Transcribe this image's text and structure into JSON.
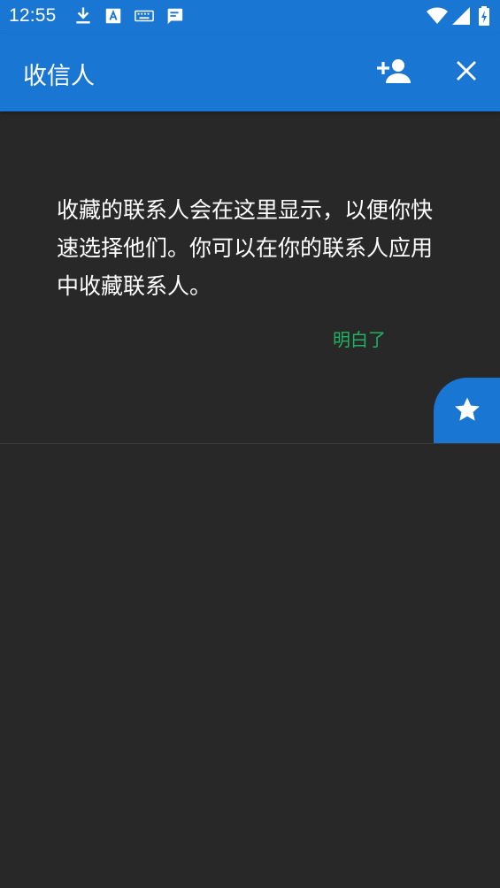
{
  "status_bar": {
    "time": "12:55",
    "icons": [
      "download-icon",
      "font-icon",
      "keyboard-icon",
      "message-icon",
      "wifi-icon",
      "signal-icon",
      "battery-charging-icon"
    ]
  },
  "app_bar": {
    "title": "收信人",
    "actions": [
      "add-contact-icon",
      "close-icon"
    ]
  },
  "favorites_empty": {
    "message": "收藏的联系人会在这里显示，以便你快速选择他们。你可以在你的联系人应用中收藏联系人。",
    "dismiss_label": "明白了"
  },
  "favorites_tab": {
    "icon": "star-icon"
  },
  "colors": {
    "primary": "#1976d2",
    "background": "#282828",
    "accent_text": "#1fb361",
    "on_primary": "#ffffff"
  }
}
